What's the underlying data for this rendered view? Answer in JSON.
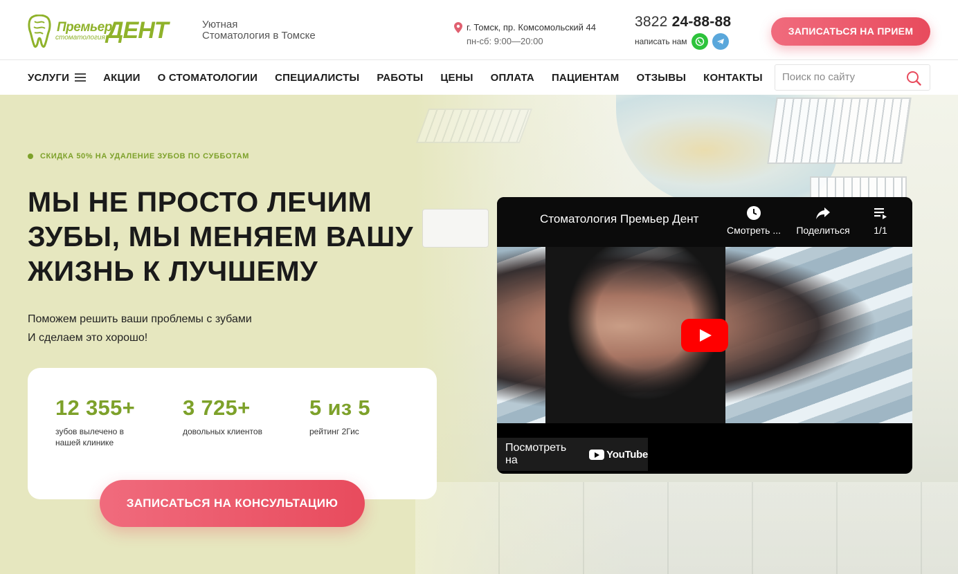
{
  "header": {
    "logo": {
      "top_text": "Премьер",
      "main_text": "ДЕНТ",
      "sub_text": "стоматология"
    },
    "tagline_line1": "Уютная",
    "tagline_line2": "Стоматология в Томске",
    "address": "г. Томск, пр. Комсомольский 44",
    "hours": "пн-сб: 9:00—20:00",
    "phone_code": "3822",
    "phone_number": "24-88-88",
    "write_us": "написать нам",
    "cta_label": "ЗАПИСАТЬСЯ НА ПРИЕМ",
    "brand_color": "#8fb22a",
    "cta_color": "#e84b5d"
  },
  "nav": {
    "items": [
      {
        "label": "УСЛУГИ"
      },
      {
        "label": "АКЦИИ"
      },
      {
        "label": "О СТОМАТОЛОГИИ"
      },
      {
        "label": "СПЕЦИАЛИСТЫ"
      },
      {
        "label": "РАБОТЫ"
      },
      {
        "label": "ЦЕНЫ"
      },
      {
        "label": "ОПЛАТА"
      },
      {
        "label": "ПАЦИЕНТАМ"
      },
      {
        "label": "ОТЗЫВЫ"
      },
      {
        "label": "КОНТАКТЫ"
      }
    ],
    "search_placeholder": "Поиск по сайту"
  },
  "hero": {
    "promo": "СКИДКА 50% НА УДАЛЕНИЕ ЗУБОВ ПО СУББОТАМ",
    "title_line1": "МЫ НЕ ПРОСТО ЛЕЧИМ",
    "title_line2": "ЗУБЫ, МЫ МЕНЯЕМ ВАШУ",
    "title_line3": "ЖИЗНЬ К ЛУЧШЕМУ",
    "subtitle_line1": "Поможем решить ваши проблемы с зубами",
    "subtitle_line2": "И сделаем это хорошо!",
    "stats": [
      {
        "value": "12 355+",
        "label": "зубов вылечено в нашей клинике"
      },
      {
        "value": "3 725+",
        "label": "довольных клиентов"
      },
      {
        "value": "5 из 5",
        "label": "рейтинг 2Гис"
      }
    ],
    "cta_label": "ЗАПИСАТЬСЯ НА КОНСУЛЬТАЦИЮ"
  },
  "video": {
    "title": "Стоматология Премьер Дент",
    "watch_later": "Смотреть ...",
    "share": "Поделиться",
    "playlist_count": "1/1",
    "watch_on": "Посмотреть на",
    "youtube_label": "YouTube"
  }
}
